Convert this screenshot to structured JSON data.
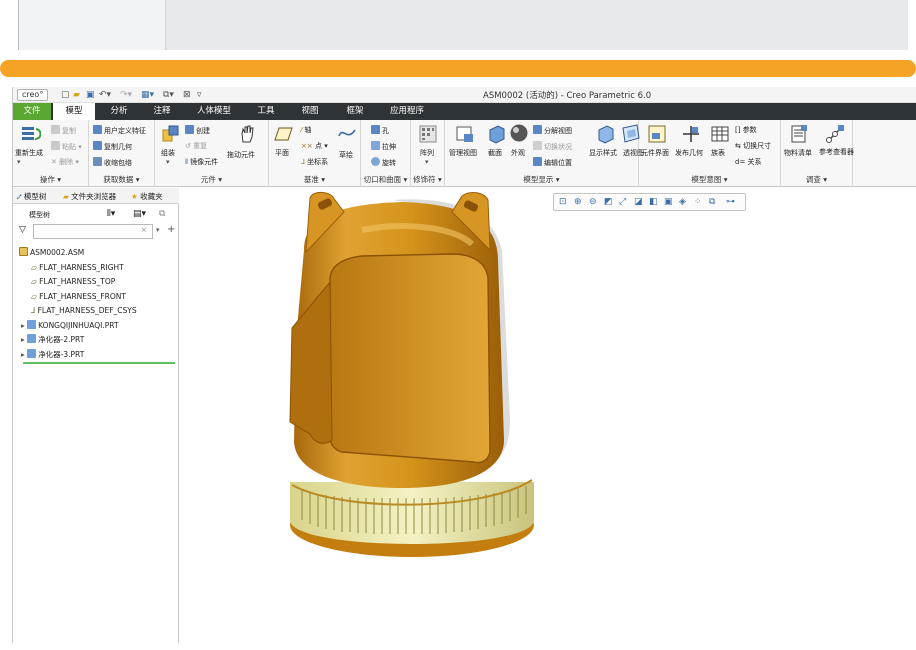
{
  "window": {
    "title": "ASM0002 (活动的) - Creo Parametric 6.0",
    "logo": "creo°"
  },
  "menu": {
    "file": "文件",
    "tabs": [
      "模型",
      "分析",
      "注释",
      "人体模型",
      "工具",
      "视图",
      "框架",
      "应用程序"
    ],
    "active_tab": "模型"
  },
  "ribbon": {
    "operations": {
      "label": "操作",
      "regenerate": "重新生成",
      "copy": "复制",
      "paste": "粘贴",
      "delete": "删除"
    },
    "get_data": {
      "label": "获取数据",
      "udf": "用户定义特征",
      "copy_geom": "复制几何",
      "shrinkwrap": "收缩包络"
    },
    "component": {
      "label": "元件",
      "assemble": "组装",
      "create": "创建",
      "repeat": "重复",
      "mirror": "镜像元件",
      "drag": "拖动元件"
    },
    "datum": {
      "label": "基准",
      "plane": "平面",
      "axis": "轴",
      "point": "点",
      "csys": "坐标系",
      "sketch": "草绘"
    },
    "cut_surface": {
      "label": "切口和曲面",
      "hole": "孔",
      "extrude": "拉伸",
      "revolve": "旋转"
    },
    "modifiers": {
      "label": "修饰符",
      "pattern": "阵列"
    },
    "model_display": {
      "label": "模型显示",
      "manage_views": "管理视图",
      "section": "截面",
      "appearance": "外观",
      "explode": "分解视图",
      "toggle_state": "切换状况",
      "edit_position": "编辑位置",
      "display_style": "显示样式",
      "perspective": "透视图"
    },
    "model_intent": {
      "label": "模型意图",
      "comp_interface": "元件界面",
      "publish_geom": "发布几何",
      "table": "族表",
      "params": "参数",
      "switch_dims": "切换尺寸",
      "relations": "关系"
    },
    "investigate": {
      "label": "调查",
      "bom": "物料清单",
      "ref_viewer": "参考查看器"
    }
  },
  "sidepanel": {
    "tabs": [
      "模型树",
      "文件夹浏览器",
      "收藏夹"
    ],
    "tree_title": "模型树",
    "filter_placeholder": "",
    "items": [
      {
        "label": "ASM0002.ASM",
        "type": "asm"
      },
      {
        "label": "FLAT_HARNESS_RIGHT",
        "type": "plane"
      },
      {
        "label": "FLAT_HARNESS_TOP",
        "type": "plane"
      },
      {
        "label": "FLAT_HARNESS_FRONT",
        "type": "plane"
      },
      {
        "label": "FLAT_HARNESS_DEF_CSYS",
        "type": "csys"
      },
      {
        "label": "KONGQIJINHUAQI.PRT",
        "type": "part"
      },
      {
        "label": "净化器-2.PRT",
        "type": "part"
      },
      {
        "label": "净化器-3.PRT",
        "type": "part"
      }
    ]
  },
  "colors": {
    "accent_orange": "#f5a324",
    "menubar": "#2d3337",
    "file_tab": "#5aa832",
    "model_body": "#d4941c",
    "model_band": "#ece9a8"
  }
}
